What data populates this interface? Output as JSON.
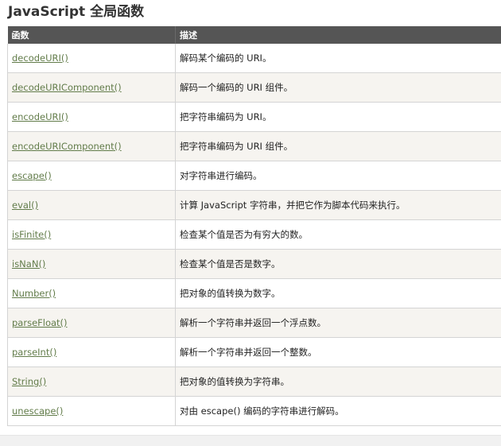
{
  "page": {
    "title": "JavaScript 全局函数"
  },
  "table": {
    "headers": [
      "函数",
      "描述"
    ],
    "rows": [
      {
        "fn": "decodeURI()",
        "desc": "解码某个编码的 URI。"
      },
      {
        "fn": "decodeURIComponent()",
        "desc": "解码一个编码的 URI 组件。"
      },
      {
        "fn": "encodeURI()",
        "desc": "把字符串编码为 URI。"
      },
      {
        "fn": "encodeURIComponent()",
        "desc": "把字符串编码为 URI 组件。"
      },
      {
        "fn": "escape()",
        "desc": "对字符串进行编码。"
      },
      {
        "fn": "eval()",
        "desc": "计算 JavaScript 字符串，并把它作为脚本代码来执行。"
      },
      {
        "fn": "isFinite()",
        "desc": "检查某个值是否为有穷大的数。"
      },
      {
        "fn": "isNaN()",
        "desc": "检查某个值是否是数字。"
      },
      {
        "fn": "Number()",
        "desc": "把对象的值转换为数字。"
      },
      {
        "fn": "parseFloat()",
        "desc": "解析一个字符串并返回一个浮点数。"
      },
      {
        "fn": "parseInt()",
        "desc": "解析一个字符串并返回一个整数。"
      },
      {
        "fn": "String()",
        "desc": "把对象的值转换为字符串。"
      },
      {
        "fn": "unescape()",
        "desc": "对由 escape() 编码的字符串进行解码。"
      }
    ]
  },
  "colors": {
    "header_bg": "#555555",
    "link": "#627c4a",
    "alt_row": "#f6f4f0"
  }
}
